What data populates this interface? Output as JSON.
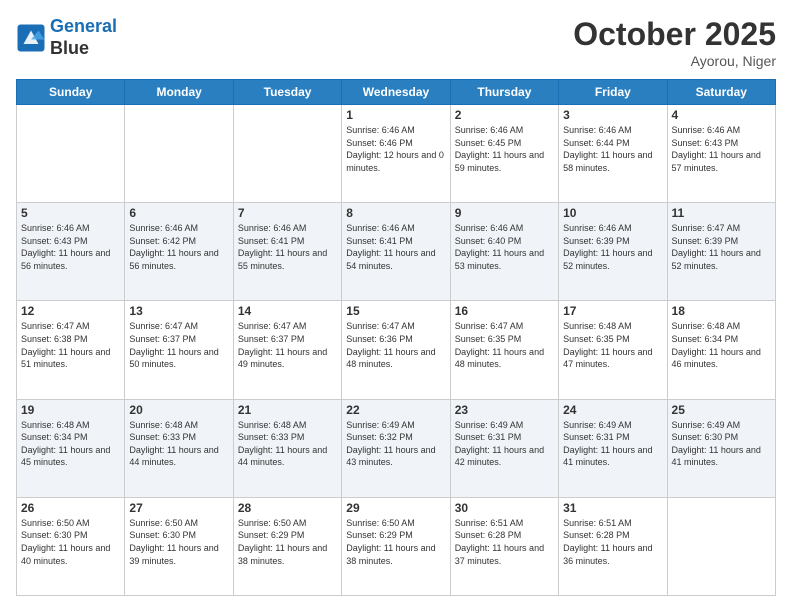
{
  "header": {
    "logo_line1": "General",
    "logo_line2": "Blue",
    "month_title": "October 2025",
    "location": "Ayorou, Niger"
  },
  "days_of_week": [
    "Sunday",
    "Monday",
    "Tuesday",
    "Wednesday",
    "Thursday",
    "Friday",
    "Saturday"
  ],
  "weeks": [
    [
      {
        "day": "",
        "sunrise": "",
        "sunset": "",
        "daylight": ""
      },
      {
        "day": "",
        "sunrise": "",
        "sunset": "",
        "daylight": ""
      },
      {
        "day": "",
        "sunrise": "",
        "sunset": "",
        "daylight": ""
      },
      {
        "day": "1",
        "sunrise": "Sunrise: 6:46 AM",
        "sunset": "Sunset: 6:46 PM",
        "daylight": "Daylight: 12 hours and 0 minutes."
      },
      {
        "day": "2",
        "sunrise": "Sunrise: 6:46 AM",
        "sunset": "Sunset: 6:45 PM",
        "daylight": "Daylight: 11 hours and 59 minutes."
      },
      {
        "day": "3",
        "sunrise": "Sunrise: 6:46 AM",
        "sunset": "Sunset: 6:44 PM",
        "daylight": "Daylight: 11 hours and 58 minutes."
      },
      {
        "day": "4",
        "sunrise": "Sunrise: 6:46 AM",
        "sunset": "Sunset: 6:43 PM",
        "daylight": "Daylight: 11 hours and 57 minutes."
      }
    ],
    [
      {
        "day": "5",
        "sunrise": "Sunrise: 6:46 AM",
        "sunset": "Sunset: 6:43 PM",
        "daylight": "Daylight: 11 hours and 56 minutes."
      },
      {
        "day": "6",
        "sunrise": "Sunrise: 6:46 AM",
        "sunset": "Sunset: 6:42 PM",
        "daylight": "Daylight: 11 hours and 56 minutes."
      },
      {
        "day": "7",
        "sunrise": "Sunrise: 6:46 AM",
        "sunset": "Sunset: 6:41 PM",
        "daylight": "Daylight: 11 hours and 55 minutes."
      },
      {
        "day": "8",
        "sunrise": "Sunrise: 6:46 AM",
        "sunset": "Sunset: 6:41 PM",
        "daylight": "Daylight: 11 hours and 54 minutes."
      },
      {
        "day": "9",
        "sunrise": "Sunrise: 6:46 AM",
        "sunset": "Sunset: 6:40 PM",
        "daylight": "Daylight: 11 hours and 53 minutes."
      },
      {
        "day": "10",
        "sunrise": "Sunrise: 6:46 AM",
        "sunset": "Sunset: 6:39 PM",
        "daylight": "Daylight: 11 hours and 52 minutes."
      },
      {
        "day": "11",
        "sunrise": "Sunrise: 6:47 AM",
        "sunset": "Sunset: 6:39 PM",
        "daylight": "Daylight: 11 hours and 52 minutes."
      }
    ],
    [
      {
        "day": "12",
        "sunrise": "Sunrise: 6:47 AM",
        "sunset": "Sunset: 6:38 PM",
        "daylight": "Daylight: 11 hours and 51 minutes."
      },
      {
        "day": "13",
        "sunrise": "Sunrise: 6:47 AM",
        "sunset": "Sunset: 6:37 PM",
        "daylight": "Daylight: 11 hours and 50 minutes."
      },
      {
        "day": "14",
        "sunrise": "Sunrise: 6:47 AM",
        "sunset": "Sunset: 6:37 PM",
        "daylight": "Daylight: 11 hours and 49 minutes."
      },
      {
        "day": "15",
        "sunrise": "Sunrise: 6:47 AM",
        "sunset": "Sunset: 6:36 PM",
        "daylight": "Daylight: 11 hours and 48 minutes."
      },
      {
        "day": "16",
        "sunrise": "Sunrise: 6:47 AM",
        "sunset": "Sunset: 6:35 PM",
        "daylight": "Daylight: 11 hours and 48 minutes."
      },
      {
        "day": "17",
        "sunrise": "Sunrise: 6:48 AM",
        "sunset": "Sunset: 6:35 PM",
        "daylight": "Daylight: 11 hours and 47 minutes."
      },
      {
        "day": "18",
        "sunrise": "Sunrise: 6:48 AM",
        "sunset": "Sunset: 6:34 PM",
        "daylight": "Daylight: 11 hours and 46 minutes."
      }
    ],
    [
      {
        "day": "19",
        "sunrise": "Sunrise: 6:48 AM",
        "sunset": "Sunset: 6:34 PM",
        "daylight": "Daylight: 11 hours and 45 minutes."
      },
      {
        "day": "20",
        "sunrise": "Sunrise: 6:48 AM",
        "sunset": "Sunset: 6:33 PM",
        "daylight": "Daylight: 11 hours and 44 minutes."
      },
      {
        "day": "21",
        "sunrise": "Sunrise: 6:48 AM",
        "sunset": "Sunset: 6:33 PM",
        "daylight": "Daylight: 11 hours and 44 minutes."
      },
      {
        "day": "22",
        "sunrise": "Sunrise: 6:49 AM",
        "sunset": "Sunset: 6:32 PM",
        "daylight": "Daylight: 11 hours and 43 minutes."
      },
      {
        "day": "23",
        "sunrise": "Sunrise: 6:49 AM",
        "sunset": "Sunset: 6:31 PM",
        "daylight": "Daylight: 11 hours and 42 minutes."
      },
      {
        "day": "24",
        "sunrise": "Sunrise: 6:49 AM",
        "sunset": "Sunset: 6:31 PM",
        "daylight": "Daylight: 11 hours and 41 minutes."
      },
      {
        "day": "25",
        "sunrise": "Sunrise: 6:49 AM",
        "sunset": "Sunset: 6:30 PM",
        "daylight": "Daylight: 11 hours and 41 minutes."
      }
    ],
    [
      {
        "day": "26",
        "sunrise": "Sunrise: 6:50 AM",
        "sunset": "Sunset: 6:30 PM",
        "daylight": "Daylight: 11 hours and 40 minutes."
      },
      {
        "day": "27",
        "sunrise": "Sunrise: 6:50 AM",
        "sunset": "Sunset: 6:30 PM",
        "daylight": "Daylight: 11 hours and 39 minutes."
      },
      {
        "day": "28",
        "sunrise": "Sunrise: 6:50 AM",
        "sunset": "Sunset: 6:29 PM",
        "daylight": "Daylight: 11 hours and 38 minutes."
      },
      {
        "day": "29",
        "sunrise": "Sunrise: 6:50 AM",
        "sunset": "Sunset: 6:29 PM",
        "daylight": "Daylight: 11 hours and 38 minutes."
      },
      {
        "day": "30",
        "sunrise": "Sunrise: 6:51 AM",
        "sunset": "Sunset: 6:28 PM",
        "daylight": "Daylight: 11 hours and 37 minutes."
      },
      {
        "day": "31",
        "sunrise": "Sunrise: 6:51 AM",
        "sunset": "Sunset: 6:28 PM",
        "daylight": "Daylight: 11 hours and 36 minutes."
      },
      {
        "day": "",
        "sunrise": "",
        "sunset": "",
        "daylight": ""
      }
    ]
  ]
}
